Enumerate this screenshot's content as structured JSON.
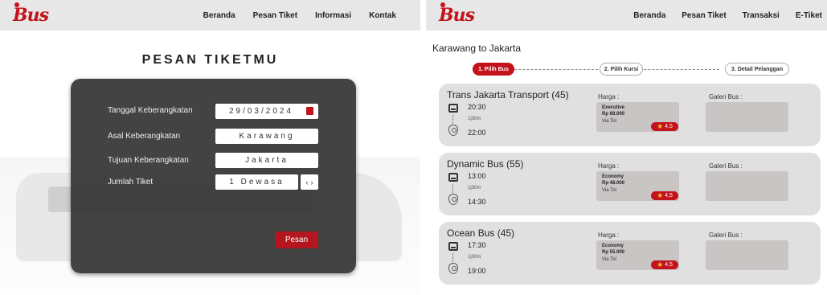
{
  "left": {
    "logo": "Bus",
    "nav": [
      "Beranda",
      "Pesan Tiket",
      "Informasi",
      "Kontak"
    ],
    "title": "PESAN TIKETMU",
    "form": {
      "date_label": "Tanggal Keberangkatan",
      "date_value": "29/03/2024",
      "origin_label": "Asal Keberangkatan",
      "origin_value": "Karawang",
      "dest_label": "Tujuan  Keberangkatan",
      "dest_value": "Jakarta",
      "tickets_label": "Jumlah Tiket",
      "tickets_value": "1 Dewasa",
      "submit": "Pesan"
    }
  },
  "right": {
    "logo": "Bus",
    "nav": [
      "Beranda",
      "Pesan Tiket",
      "Transaksi",
      "E-Tiket"
    ],
    "route": "Karawang to Jakarta",
    "steps": [
      "1. Pilih Bus",
      "2. Pilih Kursi",
      "3. Detail Pelanggan"
    ],
    "price_label": "Harga :",
    "gallery_label": "Galeri Bus :",
    "buses": [
      {
        "name": "Trans Jakarta Transport (45)",
        "depart": "20:30",
        "duration": "1j30m",
        "arrive": "22:00",
        "class": "Executive",
        "price": "Rp 68.000",
        "via": "Via Tol",
        "rating": "4,5"
      },
      {
        "name": "Dynamic Bus (55)",
        "depart": "13:00",
        "duration": "1j30m",
        "arrive": "14:30",
        "class": "Economy",
        "price": "Rp 48.000",
        "via": "Via Tol",
        "rating": "4,5"
      },
      {
        "name": "Ocean Bus (45)",
        "depart": "17:30",
        "duration": "1j30m",
        "arrive": "19:00",
        "class": "Economy",
        "price": "Rp 55.000",
        "via": "Via Tol",
        "rating": "4,5"
      }
    ]
  },
  "colors": {
    "brand_red": "#c3121b",
    "nav_bg": "#e7e7e7",
    "card_dark": "#373737",
    "bus_card": "#e0e0e0"
  }
}
